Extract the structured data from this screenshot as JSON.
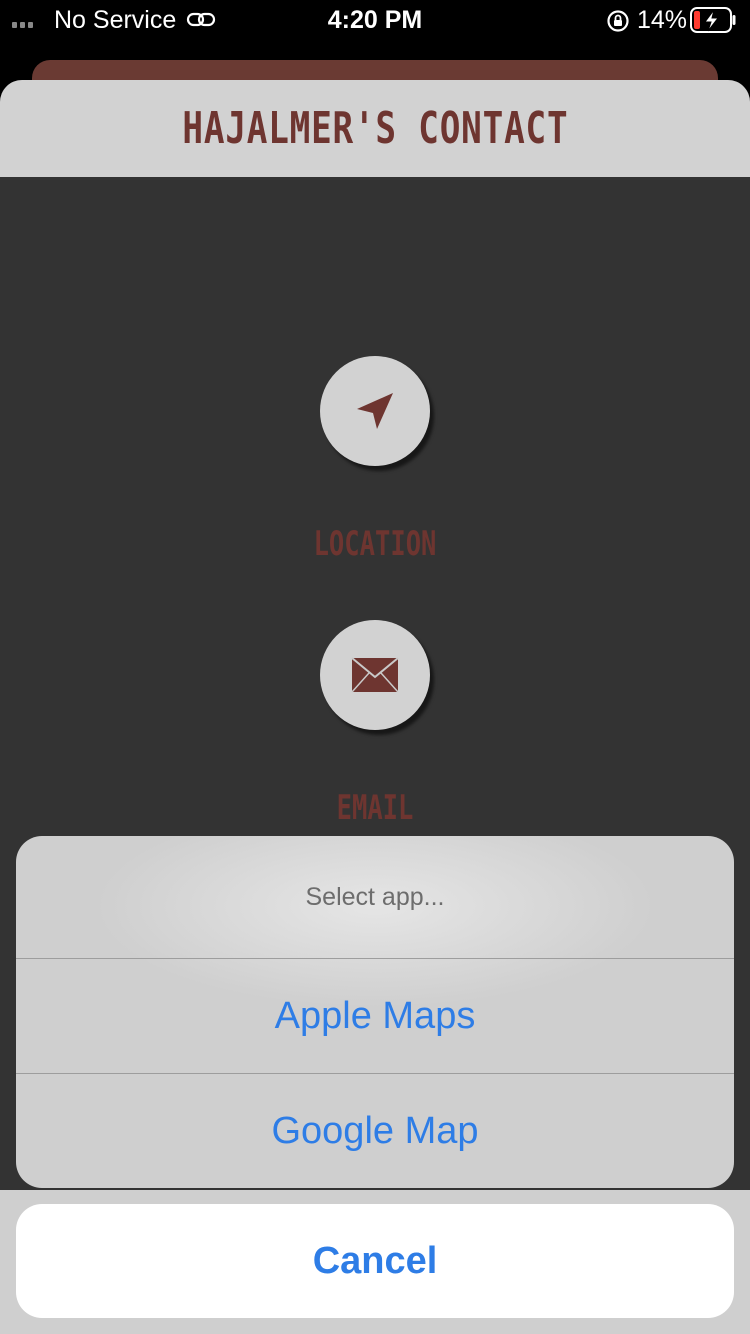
{
  "status_bar": {
    "carrier": "No Service",
    "time": "4:20 PM",
    "battery_percent": "14%"
  },
  "page": {
    "title": "HAJALMER'S CONTACT",
    "location_label": "LOCATION",
    "email_label": "EMAIL"
  },
  "action_sheet": {
    "title": "Select app...",
    "options": [
      "Apple Maps",
      "Google Map"
    ],
    "cancel": "Cancel"
  },
  "colors": {
    "accent": "#6e3530",
    "link": "#2e7de6"
  }
}
